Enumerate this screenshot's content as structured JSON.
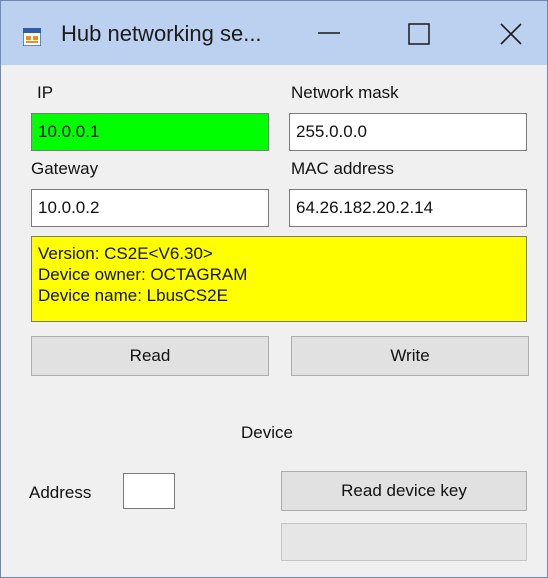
{
  "window": {
    "title": "Hub networking se...",
    "controls": {
      "minimize": "minimize-icon",
      "maximize": "maximize-icon",
      "close": "close-icon"
    }
  },
  "network": {
    "ip_label": "IP",
    "ip_value": "10.0.0.1",
    "mask_label": "Network mask",
    "mask_value": "255.0.0.0",
    "gateway_label": "Gateway",
    "gateway_value": "10.0.0.2",
    "mac_label": "MAC address",
    "mac_value": "64.26.182.20.2.14"
  },
  "info": {
    "version": "Version: CS2E<V6.30>",
    "owner": "Device owner: OCTAGRAM",
    "name": "Device name: LbusCS2E"
  },
  "buttons": {
    "read": "Read",
    "write": "Write",
    "read_key": "Read device key"
  },
  "device": {
    "heading": "Device",
    "address_label": "Address",
    "address_value": "",
    "key_value": ""
  },
  "colors": {
    "ip_field": "#00ff00",
    "info_panel": "#ffff00",
    "titlebar": "#bcd1ef"
  }
}
